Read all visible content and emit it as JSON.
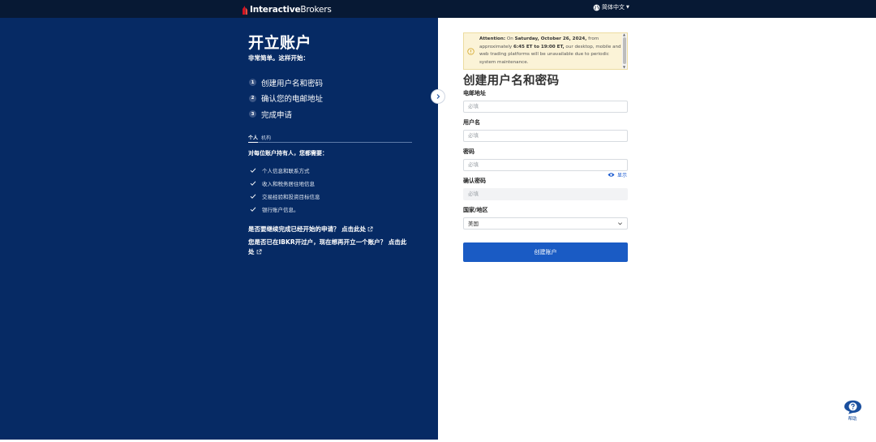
{
  "header": {
    "logo_bold": "Interactive",
    "logo_light": "Brokers",
    "language": "简体中文"
  },
  "left": {
    "title": "开立账户",
    "subtitle": "非常简单。这样开始：",
    "steps": [
      {
        "num": "1",
        "label": "创建用户名和密码"
      },
      {
        "num": "2",
        "label": "确认您的电邮地址"
      },
      {
        "num": "3",
        "label": "完成申请"
      }
    ],
    "tabs": [
      "个人",
      "机构"
    ],
    "requirements_title": "对每位账户持有人，您都需要：",
    "requirements": [
      "个人信息和联系方式",
      "收入和税务居住地信息",
      "交易经验和投资目标信息",
      "银行账户信息。"
    ],
    "link1_text": "是否要继续完成已经开始的申请？",
    "link1_action": "点击此处",
    "link2_text": "您是否已在IBKR开过户，现在想再开立一个账户？",
    "link2_action": "点击此处"
  },
  "notice": {
    "prefix": "Attention:",
    "text1": " On ",
    "date": "Saturday, October 26, 2024,",
    "text2": " from approximately ",
    "time": "6:45 ET to 19:00 ET,",
    "text3": " our desktop, mobile and web trading platforms will be unavailable due to periodic system maintenance."
  },
  "form": {
    "title": "创建用户名和密码",
    "email_label": "电邮地址",
    "email_placeholder": "必填",
    "username_label": "用户名",
    "username_placeholder": "必填",
    "password_label": "密码",
    "password_placeholder": "必填",
    "show_password": "显示",
    "confirm_label": "确认密码",
    "confirm_placeholder": "必填",
    "country_label": "国家/地区",
    "country_value": "美国",
    "submit_label": "创建账户"
  },
  "help": {
    "label": "帮助"
  },
  "colors": {
    "topbar": "#071934",
    "left_panel": "#062a64",
    "primary_button": "#1a5bc4",
    "notice_bg": "#fbf3d7"
  }
}
